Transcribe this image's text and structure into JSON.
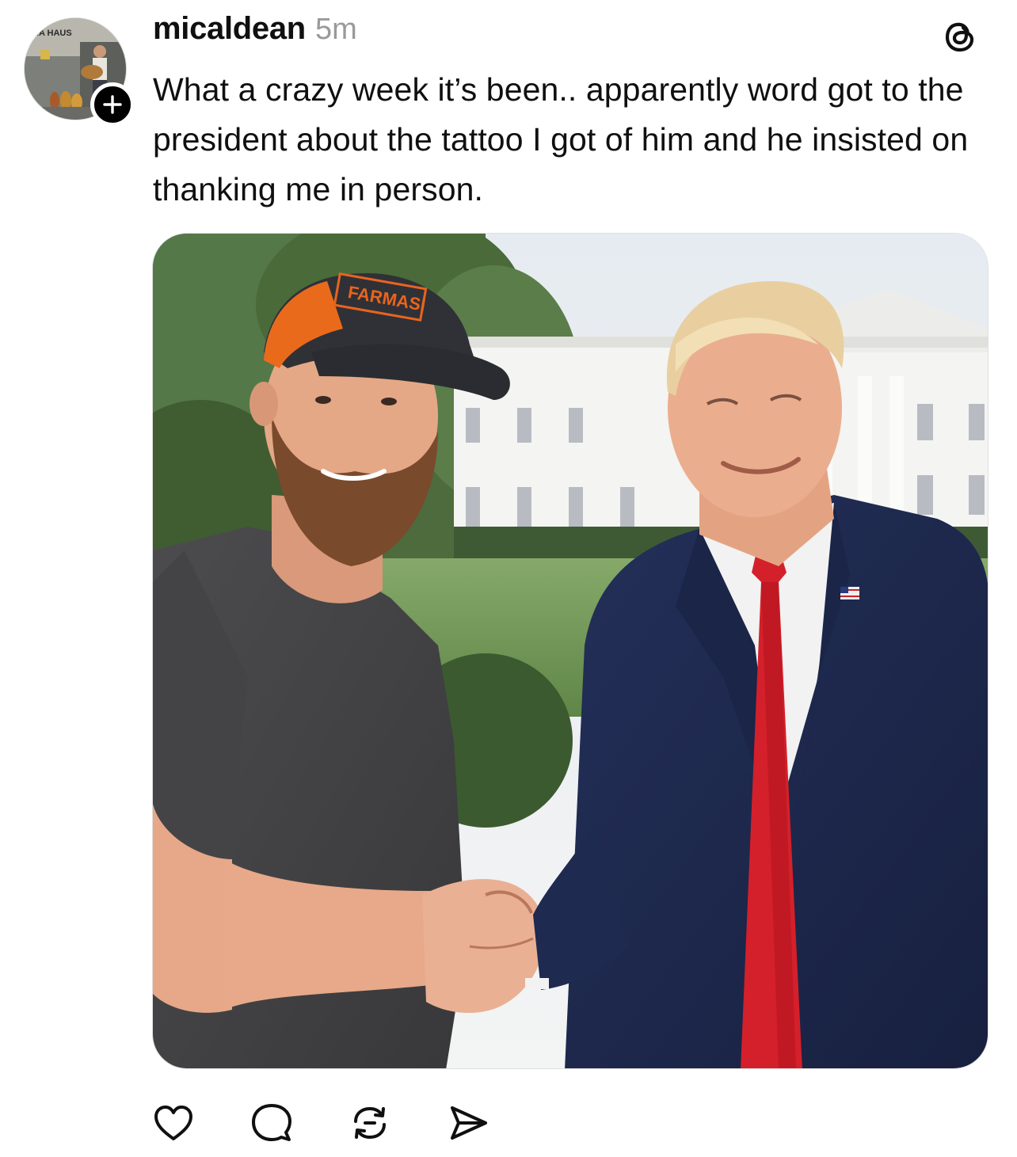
{
  "post": {
    "username": "micaldean",
    "timestamp": "5m",
    "text": "What a crazy week it’s been.. apparently word got to the president about the tattoo I got of him and he insisted on thanking me in person.",
    "hat_text": "FARMASI",
    "avatar_sign_text": "NA HAUS"
  },
  "icons": {
    "follow": "plus-icon",
    "app_logo": "threads-logo-icon",
    "like": "heart-icon",
    "reply": "comment-icon",
    "repost": "repost-icon",
    "share": "share-icon"
  },
  "colors": {
    "text": "#101010",
    "muted": "#9a9a9a",
    "hat_orange": "#e8641e",
    "tie_red": "#d4202a",
    "suit_navy": "#1d2a52"
  }
}
